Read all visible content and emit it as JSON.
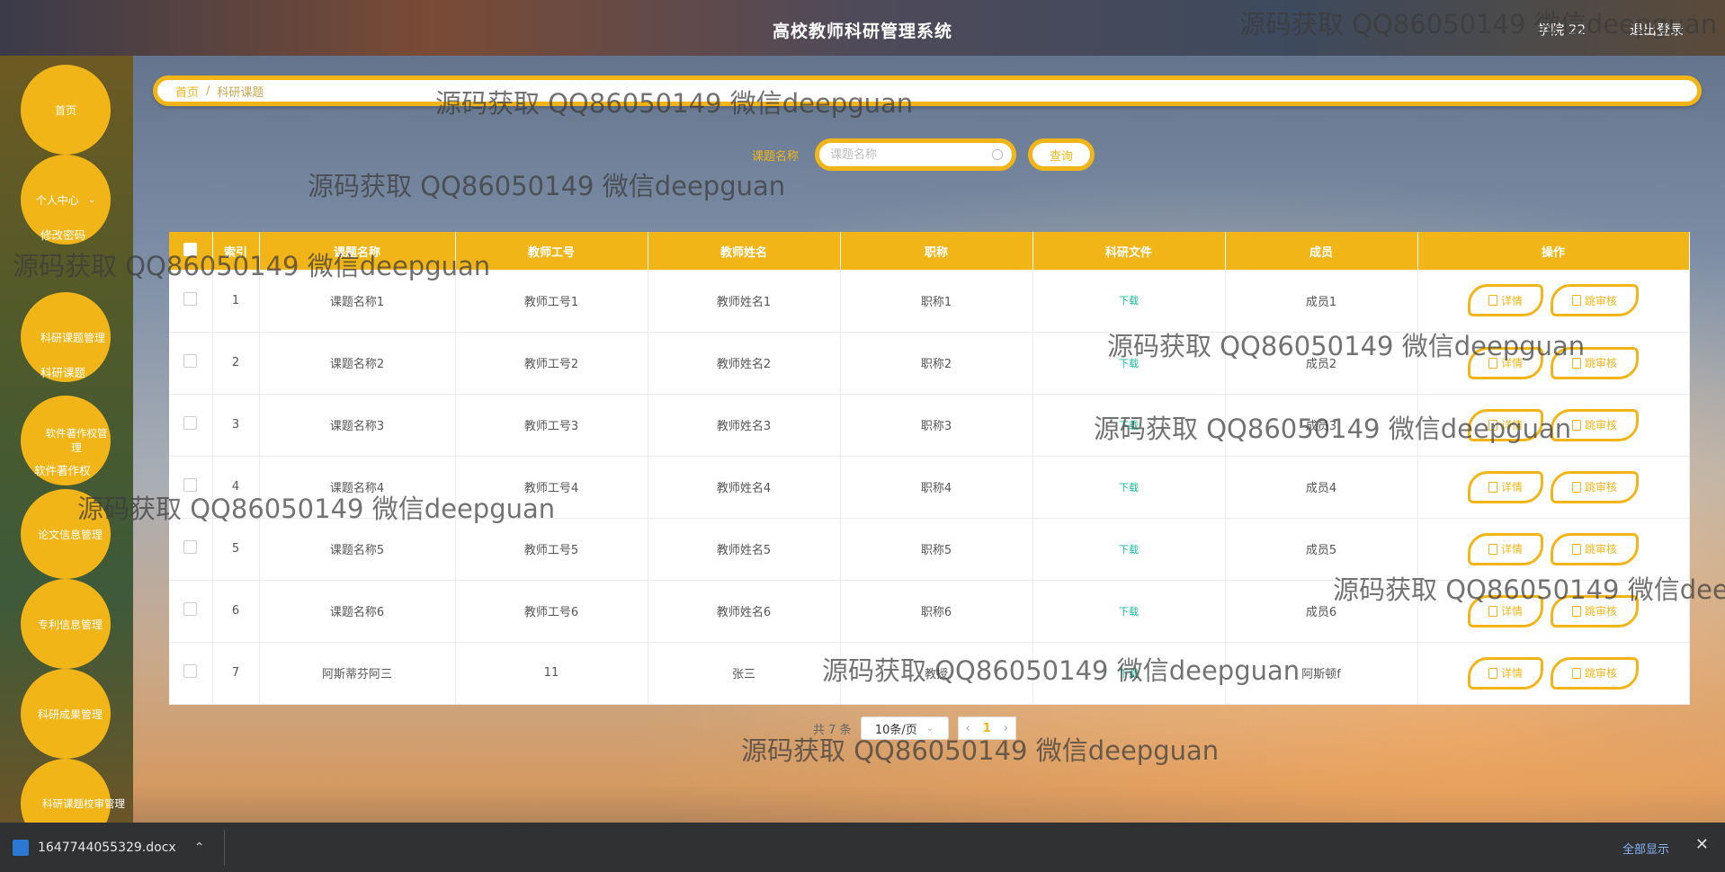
{
  "header": {
    "title": "高校教师科研管理系统",
    "user": "学院 22",
    "logout": "退出登录"
  },
  "sidebar": {
    "menu": [
      "首页",
      "个人中心",
      "科研课题管理",
      "软件著作权管理",
      "论文信息管理",
      "专利信息管理",
      "科研成果管理",
      "科研课题校审管理"
    ],
    "submenu": {
      "change_password": "修改密码",
      "research_topic": "科研课题",
      "software_copyright": "软件著作权"
    }
  },
  "breadcrumb": {
    "home": "首页",
    "sep": "/",
    "current": "科研课题"
  },
  "search": {
    "label": "课题名称",
    "placeholder": "课题名称",
    "button": "查询"
  },
  "table": {
    "headers": [
      "",
      "索引",
      "课题名称",
      "教师工号",
      "教师姓名",
      "职称",
      "科研文件",
      "成员",
      "操作"
    ],
    "rows": [
      {
        "index": "1",
        "name": "课题名称1",
        "teacher_id": "教师工号1",
        "teacher_name": "教师姓名1",
        "title": "职称1",
        "file": "下载",
        "member": "成员1"
      },
      {
        "index": "2",
        "name": "课题名称2",
        "teacher_id": "教师工号2",
        "teacher_name": "教师姓名2",
        "title": "职称2",
        "file": "下载",
        "member": "成员2"
      },
      {
        "index": "3",
        "name": "课题名称3",
        "teacher_id": "教师工号3",
        "teacher_name": "教师姓名3",
        "title": "职称3",
        "file": "下载",
        "member": "成员3"
      },
      {
        "index": "4",
        "name": "课题名称4",
        "teacher_id": "教师工号4",
        "teacher_name": "教师姓名4",
        "title": "职称4",
        "file": "下载",
        "member": "成员4"
      },
      {
        "index": "5",
        "name": "课题名称5",
        "teacher_id": "教师工号5",
        "teacher_name": "教师姓名5",
        "title": "职称5",
        "file": "下载",
        "member": "成员5"
      },
      {
        "index": "6",
        "name": "课题名称6",
        "teacher_id": "教师工号6",
        "teacher_name": "教师姓名6",
        "title": "职称6",
        "file": "下载",
        "member": "成员6"
      },
      {
        "index": "7",
        "name": "阿斯蒂芬阿三",
        "teacher_id": "11",
        "teacher_name": "张三",
        "title": "教授",
        "file": "下载",
        "member": "阿斯顿f"
      }
    ],
    "actions": {
      "detail": "详情",
      "review": "跳审核"
    }
  },
  "pagination": {
    "total": "共 7 条",
    "page_size": "10条/页",
    "current_page": "1"
  },
  "watermark": "源码获取 QQ86050149 微信deepguan",
  "download_bar": {
    "filename": "1647744055329.docx",
    "show_all": "全部显示"
  },
  "colors": {
    "accent": "#f2b518",
    "download_link": "#13ba9a"
  }
}
